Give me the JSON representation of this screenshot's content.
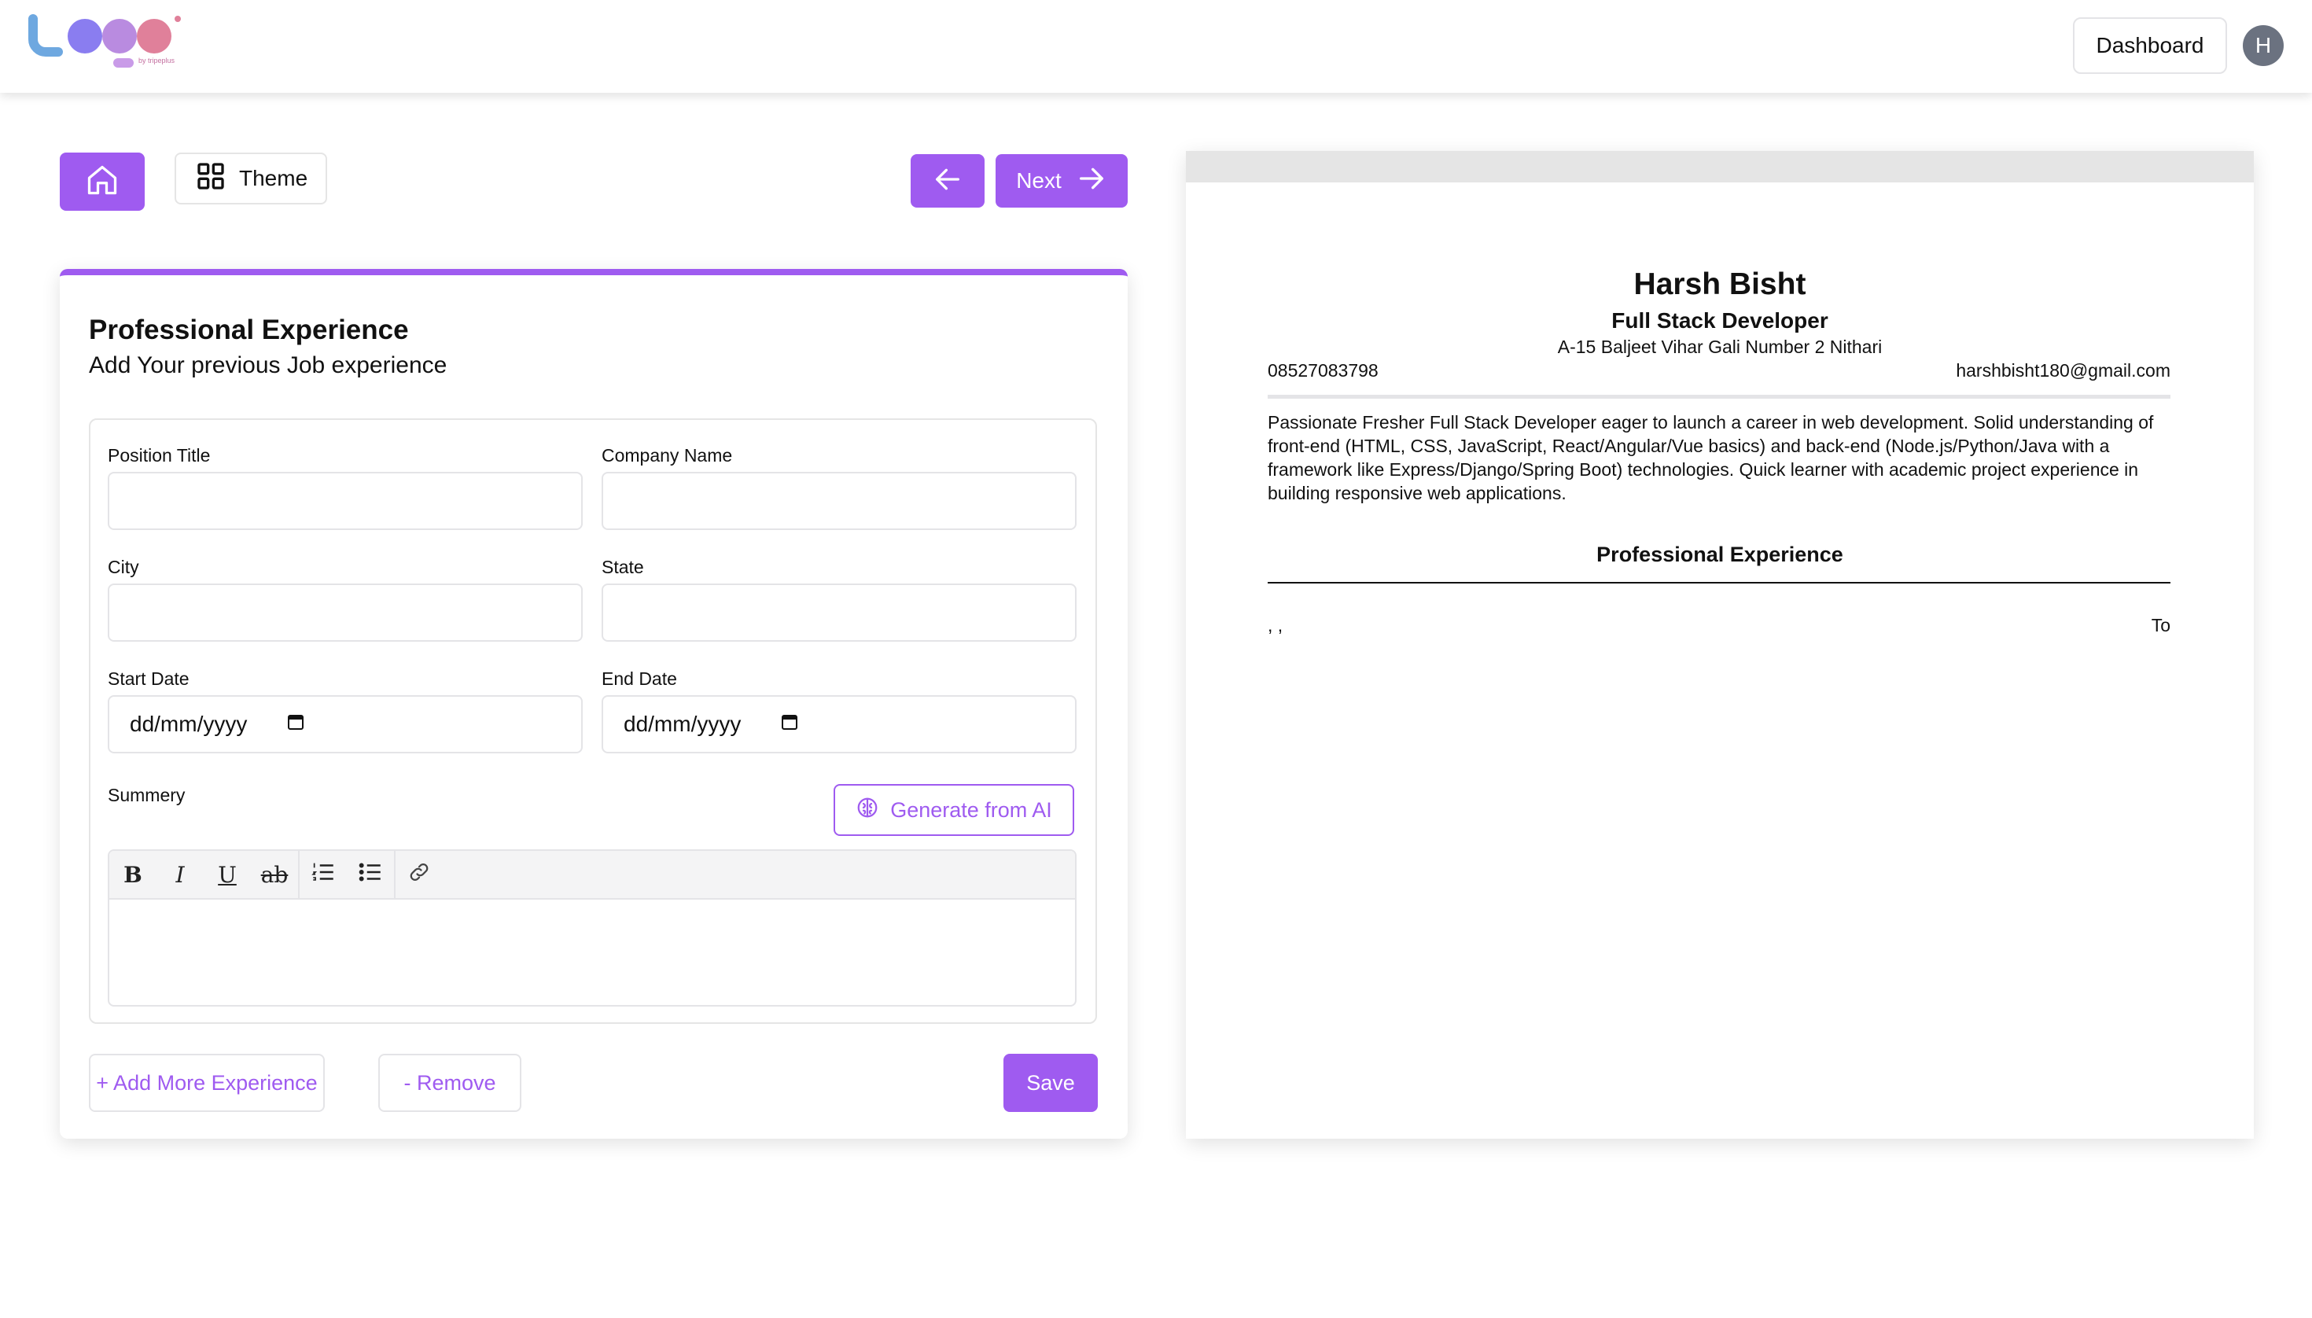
{
  "header": {
    "logo_byline": "by tripeplus",
    "dashboard_label": "Dashboard",
    "avatar_initial": "H"
  },
  "toolbar": {
    "theme_label": "Theme",
    "next_label": "Next"
  },
  "form": {
    "title": "Professional Experience",
    "subtitle": "Add Your previous Job experience",
    "fields": {
      "position_title": {
        "label": "Position Title",
        "value": ""
      },
      "company_name": {
        "label": "Company Name",
        "value": ""
      },
      "city": {
        "label": "City",
        "value": ""
      },
      "state": {
        "label": "State",
        "value": ""
      },
      "start_date": {
        "label": "Start Date",
        "placeholder": "dd/mm/yyyy"
      },
      "end_date": {
        "label": "End Date",
        "placeholder": "dd/mm/yyyy"
      },
      "summary": {
        "label": "Summery"
      }
    },
    "generate_ai_label": "Generate from AI",
    "editor_toolbar": {
      "bold": "B",
      "italic": "I",
      "underline": "U",
      "strike": "ab"
    },
    "add_more_label": "+ Add More Experience",
    "remove_label": "- Remove",
    "save_label": "Save"
  },
  "resume": {
    "name": "Harsh Bisht",
    "role": "Full Stack Developer",
    "address": "A-15 Baljeet Vihar Gali Number 2 Nithari",
    "phone": "08527083798",
    "email": "harshbisht180@gmail.com",
    "summary": "Passionate Fresher Full Stack Developer eager to launch a career in web development. Solid understanding of front-end (HTML, CSS, JavaScript, React/Angular/Vue basics) and back-end (Node.js/Python/Java with a framework like Express/Django/Spring Boot) technologies. Quick learner with academic project experience in building responsive web applications.",
    "section_title": "Professional Experience",
    "job_left": ", ,",
    "job_right": "To"
  },
  "colors": {
    "accent": "#9f5bf0",
    "border": "#e4e4e7",
    "preview_bar": "#e5e5e5"
  },
  "icons": [
    "home-icon",
    "grid-icon",
    "arrow-left-icon",
    "arrow-right-icon",
    "calendar-icon",
    "brain-icon",
    "ordered-list-icon",
    "bullet-list-icon",
    "link-icon"
  ]
}
